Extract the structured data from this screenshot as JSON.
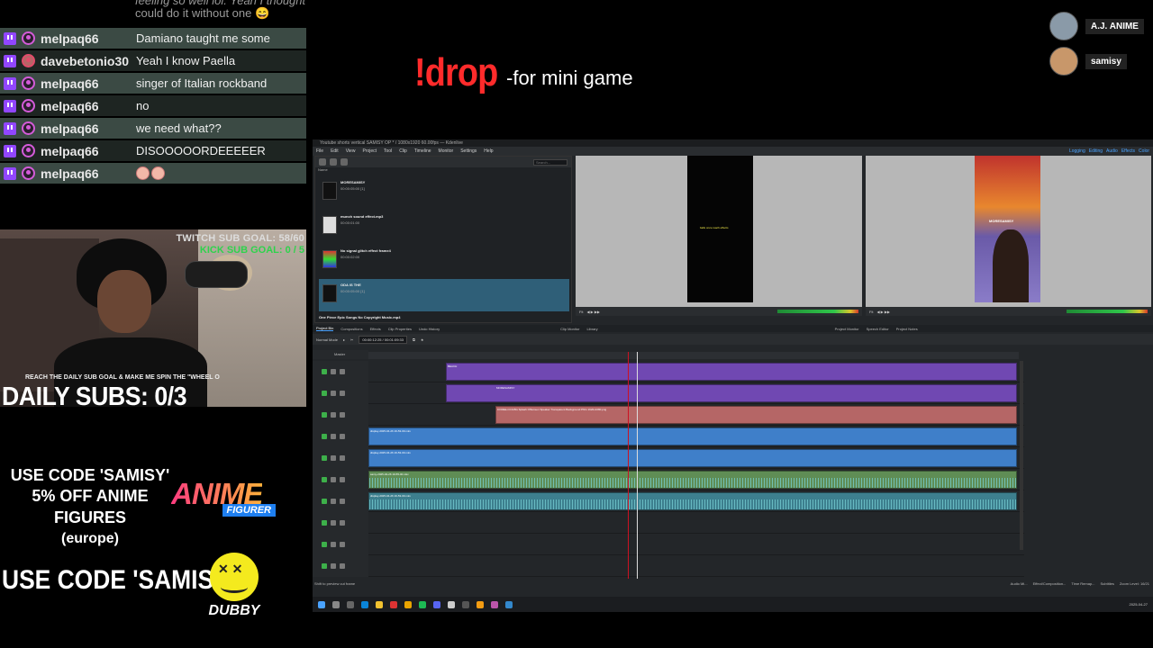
{
  "chat": {
    "partial": [
      "feeling so well lol. Yeah I thought I",
      "could do it without one 😄"
    ],
    "messages": [
      {
        "user": "melpaq66",
        "text": "Damiano taught me some"
      },
      {
        "user": "davebetonio30",
        "text": "Yeah I know Paella"
      },
      {
        "user": "melpaq66",
        "text": "singer of Italian rockband"
      },
      {
        "user": "melpaq66",
        "text": "no"
      },
      {
        "user": "melpaq66",
        "text": "we need what??"
      },
      {
        "user": "melpaq66",
        "text": "DISOOOOORDEEEEER"
      },
      {
        "user": "melpaq66",
        "text": ""
      }
    ]
  },
  "overlay": {
    "drop_cmd": "!drop",
    "drop_desc": "-for mini game",
    "viewers": [
      {
        "name": "A.J. ANIME"
      },
      {
        "name": "samisy"
      }
    ],
    "twitch_goal": "TWITCH SUB GOAL: 58/60",
    "kick_goal": "KICK SUB GOAL: 0 / 5",
    "reach_text": "REACH THE DAILY SUB GOAL & MAKE ME SPIN THE \"WHEEL O",
    "daily_subs": "DAILY SUBS: 0/3",
    "promo1_line1": "USE CODE 'SAMISY'",
    "promo1_line2": "5% OFF ANIME FIGURES",
    "promo1_line3": "(europe)",
    "anime_logo": "ANIME",
    "anime_logo_sub": "FIGURER",
    "promo2": "USE CODE 'SAMISY'",
    "dubby": "DUBBY"
  },
  "editor": {
    "title": "Youtube shorts vertical SAMISY OP * / 1080x1920 60.00fps — Kdenlive",
    "menu": [
      "File",
      "Edit",
      "View",
      "Project",
      "Tool",
      "Clip",
      "Timeline",
      "Monitor",
      "Settings",
      "Help"
    ],
    "workspaces": [
      "Logging",
      "Editing",
      "Audio",
      "Effects",
      "Color"
    ],
    "bin_name_header": "Name",
    "search_placeholder": "Search...",
    "clips": [
      {
        "name": "MORESAMISY",
        "dur": "00:00:05:00 [1]"
      },
      {
        "name": "munch sound effect.mp3",
        "dur": "00:00:01:00"
      },
      {
        "name": "No signal glitch effect frame4",
        "dur": "00:00:02:00"
      },
      {
        "name": "ODA IS THE",
        "dur": "00:00:05:00 [1]"
      },
      {
        "name": "One Piece Epic Songs No Copyright Music.mp4",
        "dur": ""
      }
    ],
    "monitor1_text": "balls once reach effects",
    "monitor2_label": "MORESAMISY",
    "zoom1": "Fit",
    "zoom2": "Fit",
    "tabs_bottom": [
      "Project Bin",
      "Compositions",
      "Effects",
      "Clip Properties",
      "Undo History"
    ],
    "tabs_mon": [
      "Clip Monitor",
      "Library"
    ],
    "tabs_mon2": [
      "Project Monitor",
      "Speech Editor",
      "Project Notes"
    ],
    "edit_mode": "Normal Mode",
    "timecode": "00:00:12:25 / 00:01:09:33",
    "master_label": "Master",
    "clip_labels": {
      "purple1": "BEACH",
      "purple2": "MORESAMISY",
      "red1": "0:FREE-CC0-BG Splash Offscreen Speaker Transparent Background PNG 1920x1080.png",
      "blue1": "display-2025-04-26 19-53-00.mkv",
      "green1": "samy-2025-04-26 19-55-00.mkv"
    },
    "status": "Shift to preview cut frame",
    "footer_tabs": [
      "Audio Mi...",
      "Effect/Composition...",
      "Time Remap...",
      "Subtitles"
    ],
    "zoom_level": "Zoom Level: 16/21",
    "clock_time": "",
    "clock_date": "2025-04-27"
  },
  "colors": {
    "drop": "#ff2b2b",
    "twitch": "#9146ff",
    "chat_alt": "#3b4a44",
    "kick": "#2ed34c"
  }
}
